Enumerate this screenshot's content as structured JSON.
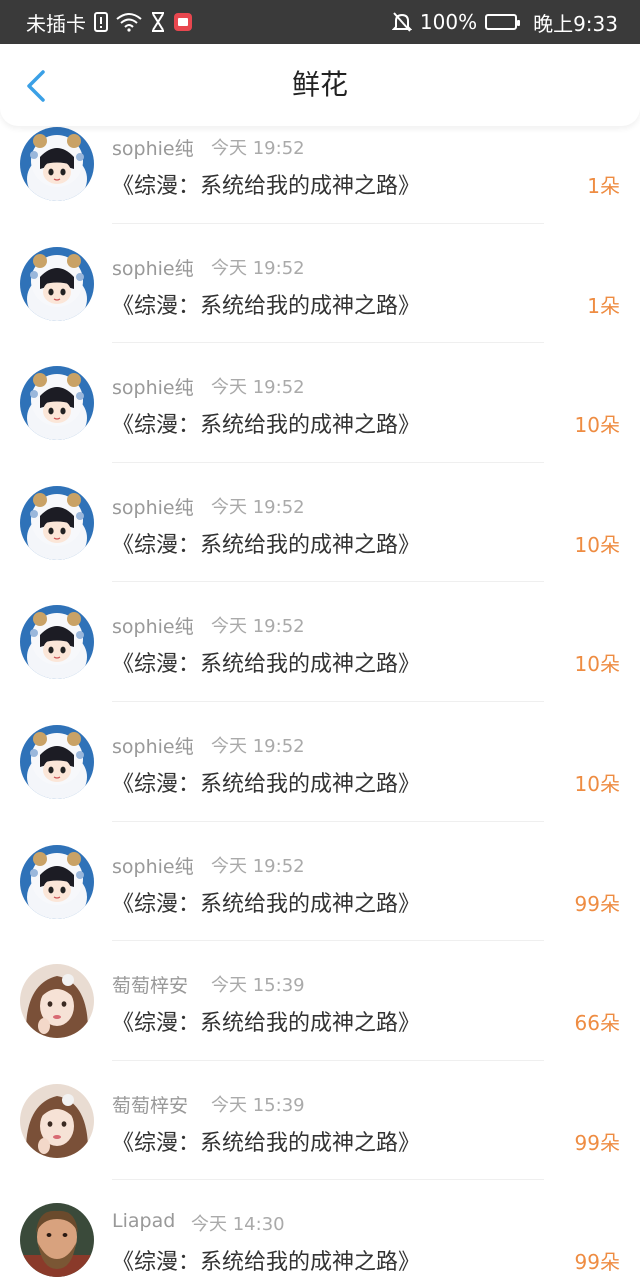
{
  "status_bar": {
    "sim_text": "未插卡",
    "battery_text": "100%",
    "time_text": "晚上9:33",
    "icons": [
      "sim-alert-icon",
      "wifi-icon",
      "hourglass-icon",
      "app-notification-icon",
      "bell-off-icon",
      "battery-icon"
    ]
  },
  "header": {
    "title": "鲜花",
    "back_icon": "chevron-left-icon",
    "accent_color": "#3aa0e6"
  },
  "items": [
    {
      "name": "sophie纯",
      "time": "今天 19:52",
      "title": "《综漫：系统给我的成神之路》",
      "count": "1朵",
      "avatar": "anime-avatar"
    },
    {
      "name": "sophie纯",
      "time": "今天 19:52",
      "title": "《综漫：系统给我的成神之路》",
      "count": "1朵",
      "avatar": "anime-avatar"
    },
    {
      "name": "sophie纯",
      "time": "今天 19:52",
      "title": "《综漫：系统给我的成神之路》",
      "count": "10朵",
      "avatar": "anime-avatar"
    },
    {
      "name": "sophie纯",
      "time": "今天 19:52",
      "title": "《综漫：系统给我的成神之路》",
      "count": "10朵",
      "avatar": "anime-avatar"
    },
    {
      "name": "sophie纯",
      "time": "今天 19:52",
      "title": "《综漫：系统给我的成神之路》",
      "count": "10朵",
      "avatar": "anime-avatar"
    },
    {
      "name": "sophie纯",
      "time": "今天 19:52",
      "title": "《综漫：系统给我的成神之路》",
      "count": "10朵",
      "avatar": "anime-avatar"
    },
    {
      "name": "sophie纯",
      "time": "今天 19:52",
      "title": "《综漫：系统给我的成神之路》",
      "count": "99朵",
      "avatar": "anime-avatar"
    },
    {
      "name": "萄萄梓安",
      "time": "今天 15:39",
      "title": "《综漫：系统给我的成神之路》",
      "count": "66朵",
      "avatar": "girl-photo-avatar"
    },
    {
      "name": "萄萄梓安",
      "time": "今天 15:39",
      "title": "《综漫：系统给我的成神之路》",
      "count": "99朵",
      "avatar": "girl-photo-avatar"
    },
    {
      "name": "Liapad",
      "time": "今天 14:30",
      "title": "《综漫：系统给我的成神之路》",
      "count": "99朵",
      "avatar": "man-photo-avatar"
    }
  ],
  "colors": {
    "count": "#ee8c42",
    "name": "#999999",
    "title": "#333333",
    "status_bar_bg": "#3a3a3a"
  }
}
